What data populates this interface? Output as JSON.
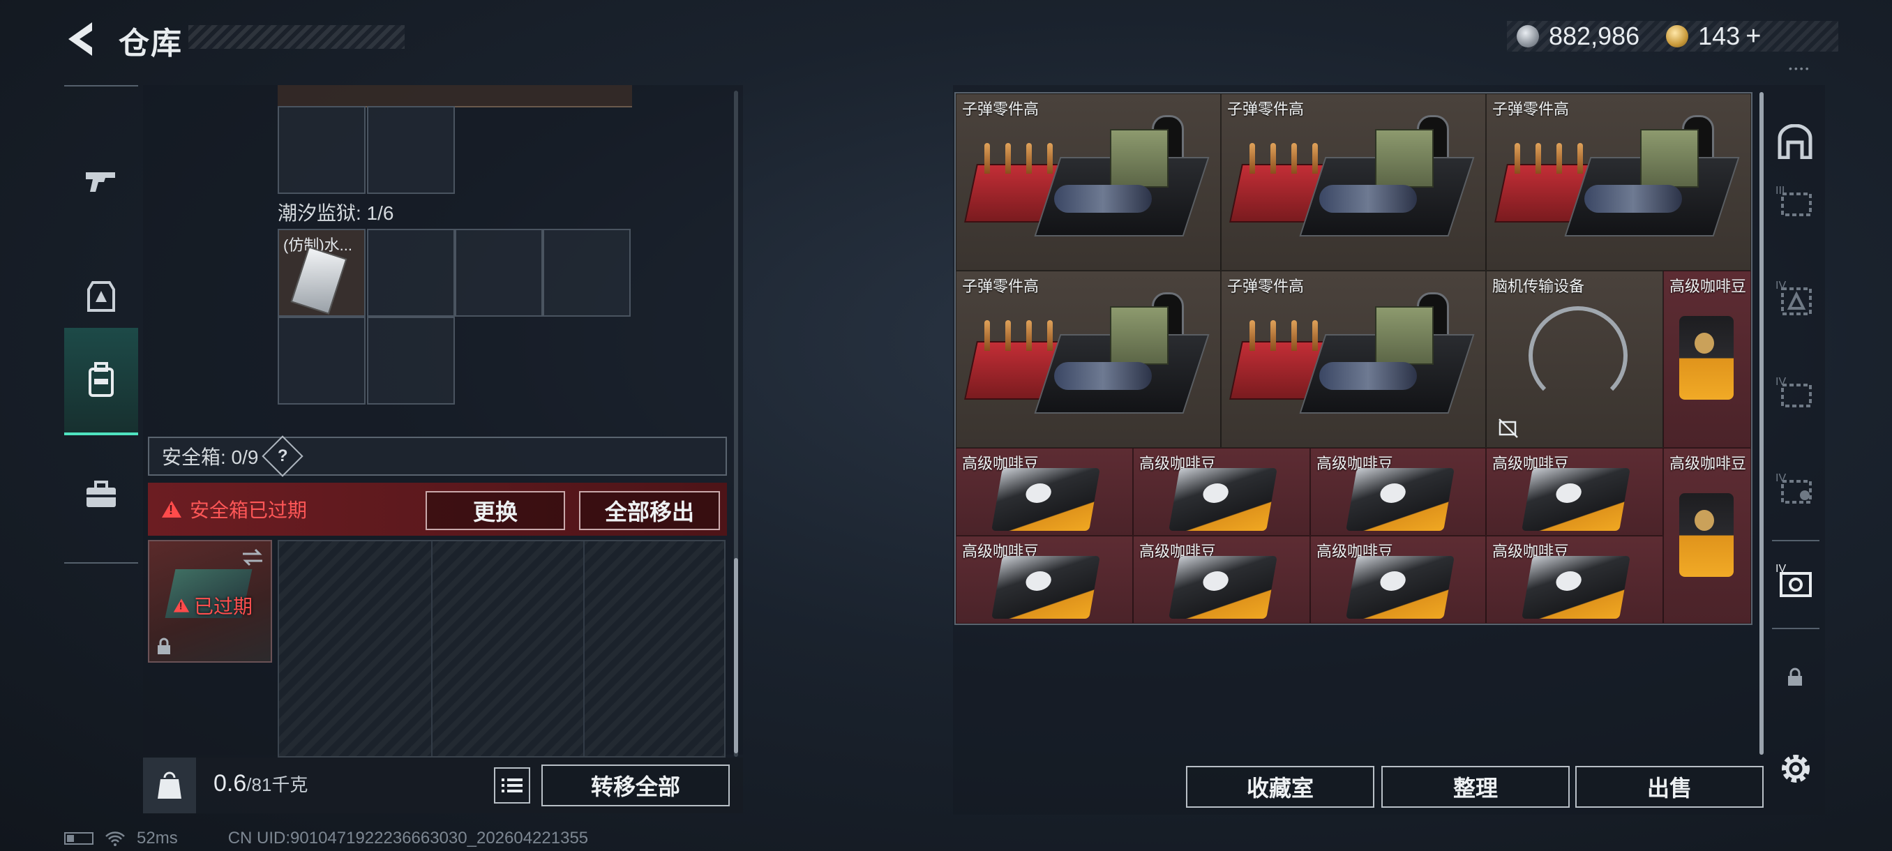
{
  "header": {
    "title": "仓库",
    "currency_silver": "882,986",
    "currency_gold": "143",
    "currency_plus": "+"
  },
  "left_panel": {
    "prison_label": "潮汐监狱: 1/6",
    "prison_item_label": "(仿制)水...",
    "safebox_label": "安全箱: 0/9",
    "safebox_help": "?",
    "expired_msg": "安全箱已过期",
    "replace_btn": "更换",
    "move_all_out_btn": "全部移出",
    "safebox_item_status": "已过期",
    "weight_value": "0.6",
    "weight_max": "/81千克",
    "transfer_all_btn": "转移全部"
  },
  "status_bar": {
    "ping": "52ms",
    "uid": "CN UID:9010471922236663030_202604221355"
  },
  "stash": {
    "items": [
      {
        "name": "子弹零件高"
      },
      {
        "name": "子弹零件高"
      },
      {
        "name": "子弹零件高"
      },
      {
        "name": "子弹零件高"
      },
      {
        "name": "子弹零件高"
      },
      {
        "name": "脑机传输设备"
      },
      {
        "name": "高级咖啡豆"
      },
      {
        "name": "高级咖啡豆"
      },
      {
        "name": "高级咖啡豆"
      },
      {
        "name": "高级咖啡豆"
      },
      {
        "name": "高级咖啡豆"
      },
      {
        "name": "高级咖啡豆"
      },
      {
        "name": "高级咖啡豆"
      },
      {
        "name": "高级咖啡豆"
      },
      {
        "name": "高级咖啡豆"
      },
      {
        "name": "高级咖啡豆"
      }
    ],
    "collection_btn": "收藏室",
    "sort_btn": "整理",
    "sell_btn": "出售"
  },
  "colors": {
    "accent": "#4fe3c0",
    "alert": "#ff4b4b",
    "alert_bg": "#6c1d22"
  }
}
